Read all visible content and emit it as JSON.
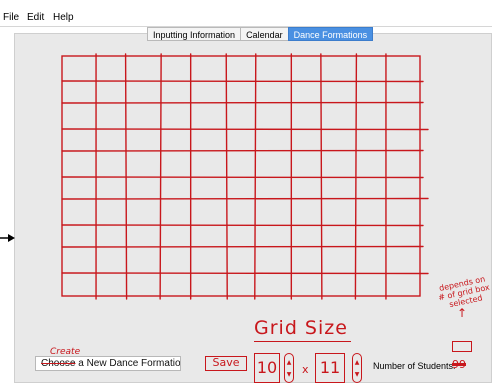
{
  "menu": {
    "items": [
      "File",
      "Edit",
      "Help"
    ]
  },
  "tabs": [
    {
      "label": "Inputting Information",
      "active": false
    },
    {
      "label": "Calendar",
      "active": false
    },
    {
      "label": "Dance Formations",
      "active": true
    }
  ],
  "grid": {
    "columns": 11,
    "rows": 10,
    "line_color": "#c8171c"
  },
  "annotations": {
    "create_note": "Create",
    "grid_size_title": "Grid Size",
    "depends_note": "depends on # of grid box selected",
    "arrow_icon": "arrow-right-icon"
  },
  "controls": {
    "name_field": {
      "struck_word": "Choose",
      "rest": " a New Dance Formation"
    },
    "save_label": "Save",
    "rows_value": "10",
    "columns_value": "11",
    "times_symbol": "x",
    "students_label": "Number of Students:",
    "students_value": "99"
  },
  "colors": {
    "accent_tab": "#4a90e2",
    "sketch_red": "#c8171c",
    "panel_bg": "#e9e9e9"
  }
}
